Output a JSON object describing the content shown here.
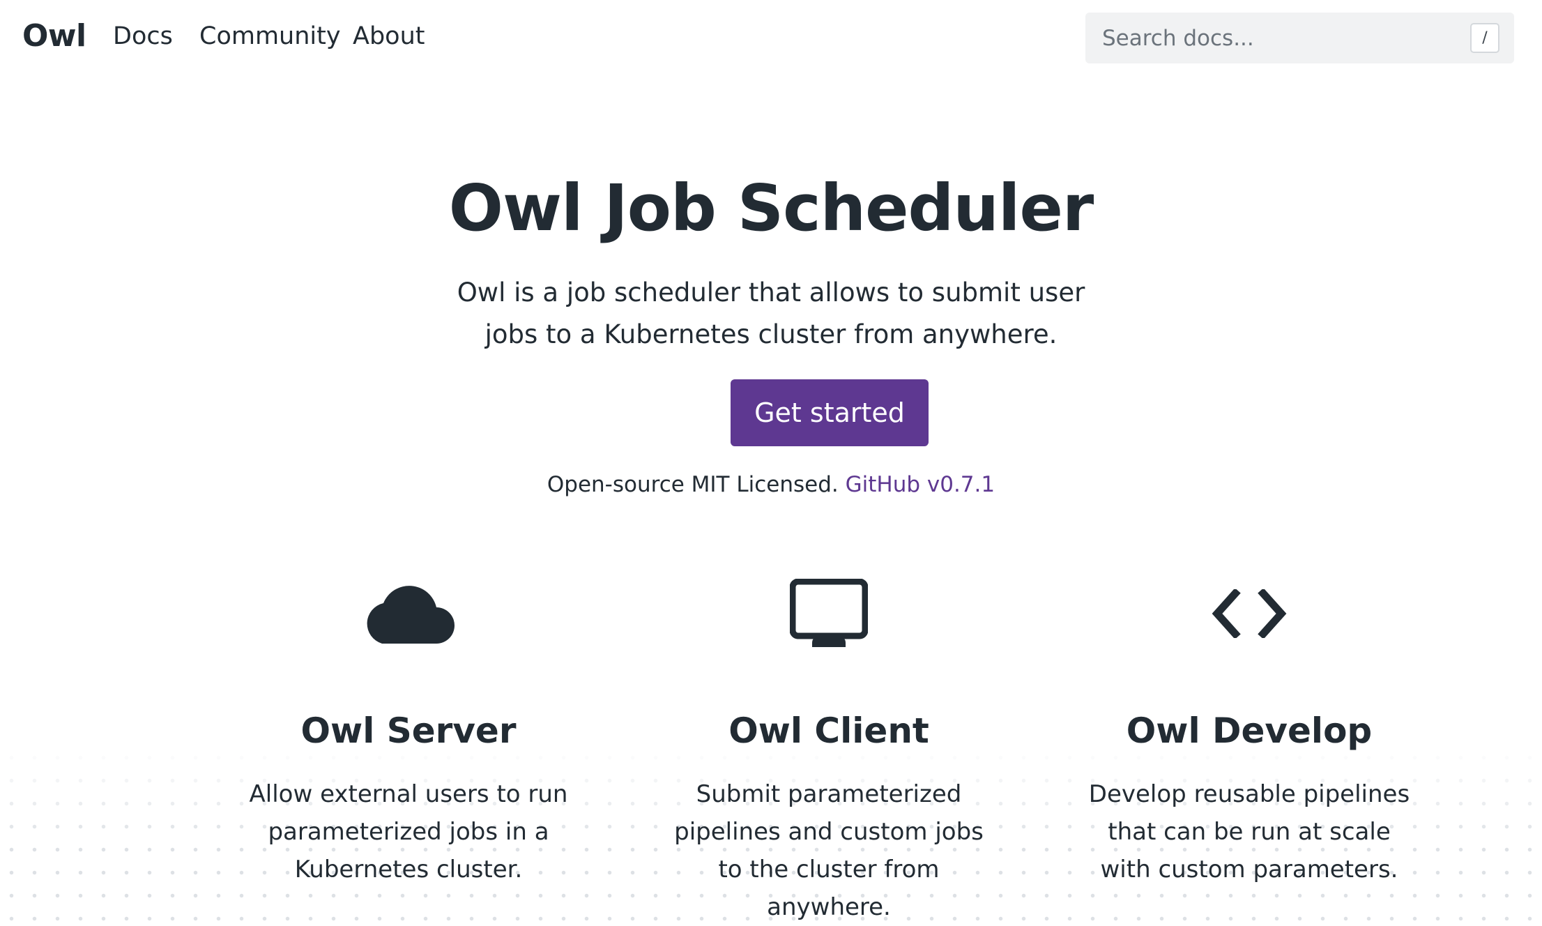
{
  "nav": {
    "brand": "Owl",
    "links": [
      "Docs",
      "Community",
      "About"
    ]
  },
  "search": {
    "placeholder": "Search docs...",
    "shortcut": "/"
  },
  "hero": {
    "title": "Owl Job Scheduler",
    "description": "Owl is a job scheduler that allows to submit user jobs to a Kubernetes cluster from anywhere.",
    "cta_label": "Get started",
    "license_text": "Open-source MIT Licensed.",
    "github_link": "GitHub v0.7.1"
  },
  "features": [
    {
      "icon": "cloud-icon",
      "title": "Owl Server",
      "description": "Allow external users to run parameterized jobs in a Kubernetes cluster."
    },
    {
      "icon": "monitor-icon",
      "title": "Owl Client",
      "description": "Submit parameterized pipelines and custom jobs to the cluster from anywhere."
    },
    {
      "icon": "code-icon",
      "title": "Owl Develop",
      "description": "Develop reusable pipelines that can be run at scale with custom parameters."
    }
  ],
  "colors": {
    "accent": "#5e3891",
    "text": "#222b33",
    "search_bg": "#f1f2f3"
  }
}
